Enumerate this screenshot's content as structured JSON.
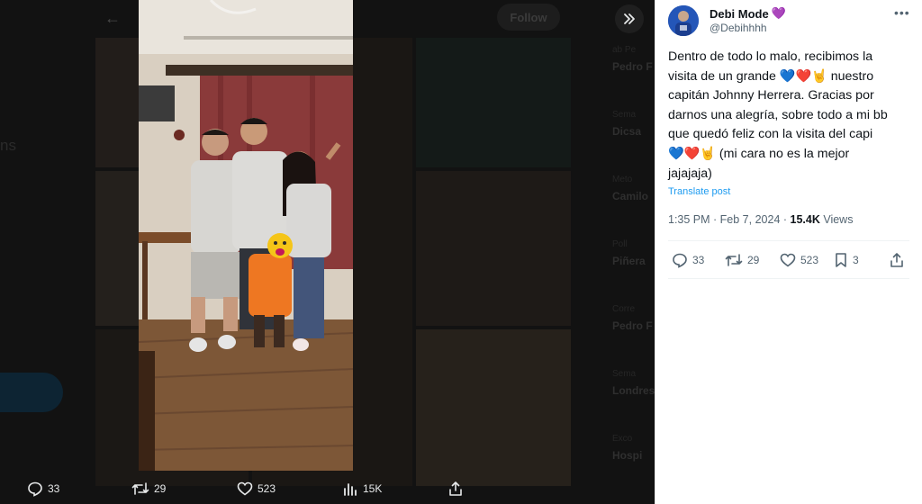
{
  "background": {
    "follow_label": "Follow",
    "faint_left_text": "ns",
    "side_items": [
      {
        "small": "ab Pe",
        "name": "Pedro F"
      },
      {
        "small": "Sema",
        "name": "Dicsa"
      },
      {
        "small": "Meto",
        "name": "Camilo"
      },
      {
        "small": "Poll",
        "name": "Piñera"
      },
      {
        "small": "Corre",
        "name": "Pedro F"
      },
      {
        "small": "Sema",
        "name": "Londres"
      },
      {
        "small": "Exco",
        "name": "Hospi"
      }
    ]
  },
  "media_bar": {
    "replies": "33",
    "reposts": "29",
    "likes": "523",
    "views": "15K"
  },
  "tweet": {
    "display_name": "Debi Mode",
    "name_emoji": "💜",
    "handle": "@Debihhhh",
    "text_lines": [
      "Dentro de todo lo malo, recibimos la",
      "visita de un grande 💙❤️🤘 nuestro",
      "capitán Johnny Herrera. Gracias por",
      "darnos una alegría, sobre todo a mi bb",
      "que quedó feliz con la visita del capi",
      "💙❤️🤘 (mi cara no es la mejor",
      "jajajaja)"
    ],
    "translate_label": "Translate post",
    "time": "1:35 PM",
    "sep": " · ",
    "date": "Feb 7, 2024",
    "views_count": "15.4K",
    "views_label": " Views",
    "actions": {
      "replies": "33",
      "reposts": "29",
      "likes": "523",
      "bookmarks": "3"
    }
  },
  "colors": {
    "accent": "#1d9bf0",
    "text_primary": "#0f1419",
    "text_secondary": "#536471"
  }
}
